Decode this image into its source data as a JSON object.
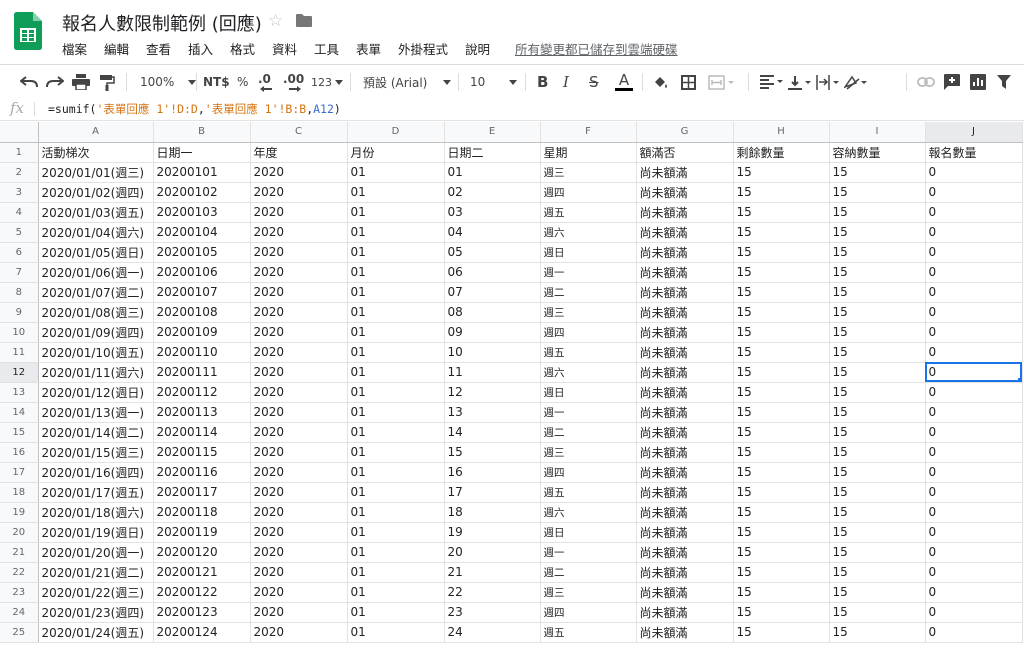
{
  "doc": {
    "title": "報名人數限制範例 (回應)",
    "saved_status": "所有變更都已儲存到雲端硬碟"
  },
  "menu": [
    "檔案",
    "編輯",
    "查看",
    "插入",
    "格式",
    "資料",
    "工具",
    "表單",
    "外掛程式",
    "說明"
  ],
  "toolbar": {
    "zoom": "100%",
    "currency": "NT$",
    "percent": "%",
    "decrease_decimals": ".0",
    "increase_decimals": ".00",
    "more_formats": "123",
    "font": "預設 (Arial)",
    "font_size": "10",
    "bold": "B",
    "italic": "I",
    "strike": "S",
    "text_color": "A",
    "text_color_hex": "#000000"
  },
  "formula_bar": {
    "fx_label": "fx",
    "parts": [
      "=sumif(",
      "'表單回應 1'!D:D",
      ",",
      "'表單回應 1'!B:B",
      ",",
      "A12",
      ")"
    ]
  },
  "columns": [
    "A",
    "B",
    "C",
    "D",
    "E",
    "F",
    "G",
    "H",
    "I",
    "J"
  ],
  "headers": [
    "活動梯次",
    "日期一",
    "年度",
    "月份",
    "日期二",
    "星期",
    "額滿否",
    "剩餘數量",
    "容納數量",
    "報名數量"
  ],
  "rows": [
    [
      "2020/01/01(週三)",
      "20200101",
      "2020",
      "01",
      "01",
      "週三",
      "尚未額滿",
      "15",
      "15",
      "0"
    ],
    [
      "2020/01/02(週四)",
      "20200102",
      "2020",
      "01",
      "02",
      "週四",
      "尚未額滿",
      "15",
      "15",
      "0"
    ],
    [
      "2020/01/03(週五)",
      "20200103",
      "2020",
      "01",
      "03",
      "週五",
      "尚未額滿",
      "15",
      "15",
      "0"
    ],
    [
      "2020/01/04(週六)",
      "20200104",
      "2020",
      "01",
      "04",
      "週六",
      "尚未額滿",
      "15",
      "15",
      "0"
    ],
    [
      "2020/01/05(週日)",
      "20200105",
      "2020",
      "01",
      "05",
      "週日",
      "尚未額滿",
      "15",
      "15",
      "0"
    ],
    [
      "2020/01/06(週一)",
      "20200106",
      "2020",
      "01",
      "06",
      "週一",
      "尚未額滿",
      "15",
      "15",
      "0"
    ],
    [
      "2020/01/07(週二)",
      "20200107",
      "2020",
      "01",
      "07",
      "週二",
      "尚未額滿",
      "15",
      "15",
      "0"
    ],
    [
      "2020/01/08(週三)",
      "20200108",
      "2020",
      "01",
      "08",
      "週三",
      "尚未額滿",
      "15",
      "15",
      "0"
    ],
    [
      "2020/01/09(週四)",
      "20200109",
      "2020",
      "01",
      "09",
      "週四",
      "尚未額滿",
      "15",
      "15",
      "0"
    ],
    [
      "2020/01/10(週五)",
      "20200110",
      "2020",
      "01",
      "10",
      "週五",
      "尚未額滿",
      "15",
      "15",
      "0"
    ],
    [
      "2020/01/11(週六)",
      "20200111",
      "2020",
      "01",
      "11",
      "週六",
      "尚未額滿",
      "15",
      "15",
      "0"
    ],
    [
      "2020/01/12(週日)",
      "20200112",
      "2020",
      "01",
      "12",
      "週日",
      "尚未額滿",
      "15",
      "15",
      "0"
    ],
    [
      "2020/01/13(週一)",
      "20200113",
      "2020",
      "01",
      "13",
      "週一",
      "尚未額滿",
      "15",
      "15",
      "0"
    ],
    [
      "2020/01/14(週二)",
      "20200114",
      "2020",
      "01",
      "14",
      "週二",
      "尚未額滿",
      "15",
      "15",
      "0"
    ],
    [
      "2020/01/15(週三)",
      "20200115",
      "2020",
      "01",
      "15",
      "週三",
      "尚未額滿",
      "15",
      "15",
      "0"
    ],
    [
      "2020/01/16(週四)",
      "20200116",
      "2020",
      "01",
      "16",
      "週四",
      "尚未額滿",
      "15",
      "15",
      "0"
    ],
    [
      "2020/01/17(週五)",
      "20200117",
      "2020",
      "01",
      "17",
      "週五",
      "尚未額滿",
      "15",
      "15",
      "0"
    ],
    [
      "2020/01/18(週六)",
      "20200118",
      "2020",
      "01",
      "18",
      "週六",
      "尚未額滿",
      "15",
      "15",
      "0"
    ],
    [
      "2020/01/19(週日)",
      "20200119",
      "2020",
      "01",
      "19",
      "週日",
      "尚未額滿",
      "15",
      "15",
      "0"
    ],
    [
      "2020/01/20(週一)",
      "20200120",
      "2020",
      "01",
      "20",
      "週一",
      "尚未額滿",
      "15",
      "15",
      "0"
    ],
    [
      "2020/01/21(週二)",
      "20200121",
      "2020",
      "01",
      "21",
      "週二",
      "尚未額滿",
      "15",
      "15",
      "0"
    ],
    [
      "2020/01/22(週三)",
      "20200122",
      "2020",
      "01",
      "22",
      "週三",
      "尚未額滿",
      "15",
      "15",
      "0"
    ],
    [
      "2020/01/23(週四)",
      "20200123",
      "2020",
      "01",
      "23",
      "週四",
      "尚未額滿",
      "15",
      "15",
      "0"
    ],
    [
      "2020/01/24(週五)",
      "20200124",
      "2020",
      "01",
      "24",
      "週五",
      "尚未額滿",
      "15",
      "15",
      "0"
    ]
  ],
  "selected_cell": "J12",
  "colors": {
    "sheets_green": "#0f9d58",
    "selection_blue": "#1a73e8",
    "formula_range_orange": "#d47311",
    "formula_ref_blue": "#3b6fd6"
  }
}
